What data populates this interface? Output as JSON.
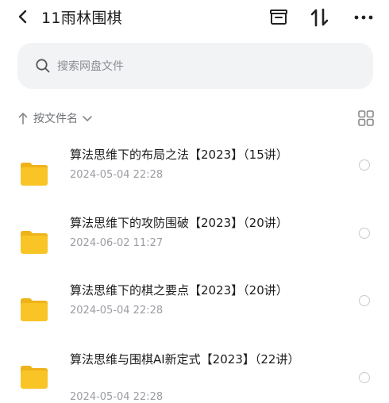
{
  "header": {
    "title": "11雨林围棋",
    "icons": [
      "back-chevron-icon",
      "archive-icon",
      "transfer-icon",
      "more-icon"
    ]
  },
  "search": {
    "placeholder": "搜索网盘文件",
    "value": ""
  },
  "sort": {
    "label": "按文件名"
  },
  "colors": {
    "folder": "#f9c426",
    "folder_back": "#efb31a",
    "text_secondary": "#9b9da3"
  },
  "files": [
    {
      "name": "算法思维下的布局之法【2023】（15讲）",
      "date": "2024-05-04  22:28"
    },
    {
      "name": "算法思维下的攻防围破【2023】（20讲）",
      "date": "2024-06-02  11:27"
    },
    {
      "name": "算法思维下的棋之要点【2023】（20讲）",
      "date": "2024-05-04  22:28"
    },
    {
      "name": "算法思维与围棋AI新定式【2023】（22讲）",
      "date": "2024-05-04  22:28"
    }
  ]
}
